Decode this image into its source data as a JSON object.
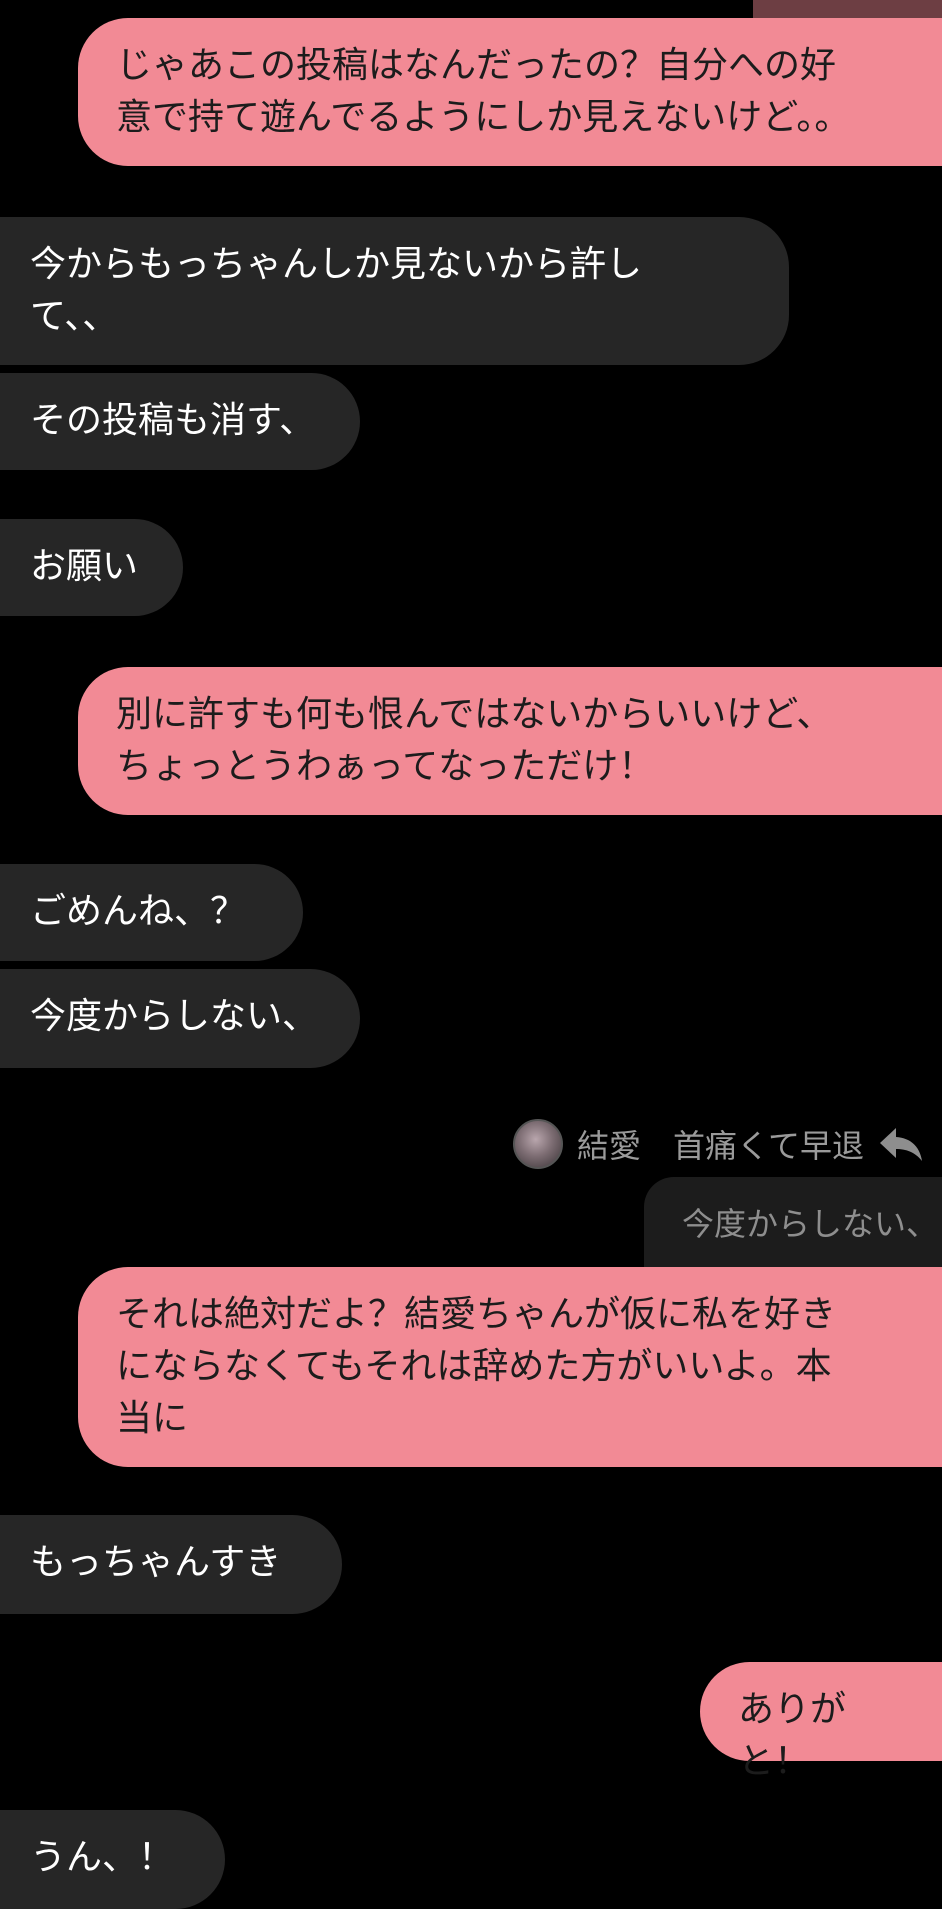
{
  "conversation": {
    "messages": [
      {
        "direction": "out",
        "text": "じゃあこの投稿はなんだったの？自分への好\n意で持て遊んでるようにしか見えないけど。。"
      },
      {
        "direction": "in",
        "text": "今からもっちゃんしか見ないから許し\nて、、"
      },
      {
        "direction": "in",
        "text": "その投稿も消す、"
      },
      {
        "direction": "in",
        "text": "お願い"
      },
      {
        "direction": "out",
        "text": "別に許すも何も恨んではないからいいけど、\nちょっとうわぁってなっただけ！"
      },
      {
        "direction": "in",
        "text": "ごめんね、？"
      },
      {
        "direction": "in",
        "text": "今度からしない、"
      },
      {
        "direction": "out",
        "text": "それは絶対だよ？結愛ちゃんが仮に私を好き\nにならなくてもそれは辞めた方がいいよ。本\n当に"
      },
      {
        "direction": "in",
        "text": "もっちゃんすき"
      },
      {
        "direction": "out",
        "text": "ありがと！"
      },
      {
        "direction": "in",
        "text": "うん、！"
      }
    ],
    "reply_context": {
      "sender_name": "結愛",
      "sender_status": "首痛くて早退",
      "quoted_text": "今度からしない、",
      "icon": "reply-arrow-icon"
    }
  },
  "colors": {
    "background": "#000000",
    "incoming_bubble": "#262626",
    "outgoing_bubble": "#f28a95",
    "outgoing_text": "#1c1c1c",
    "incoming_text": "#ffffff",
    "muted_text": "#9a9a9a"
  }
}
